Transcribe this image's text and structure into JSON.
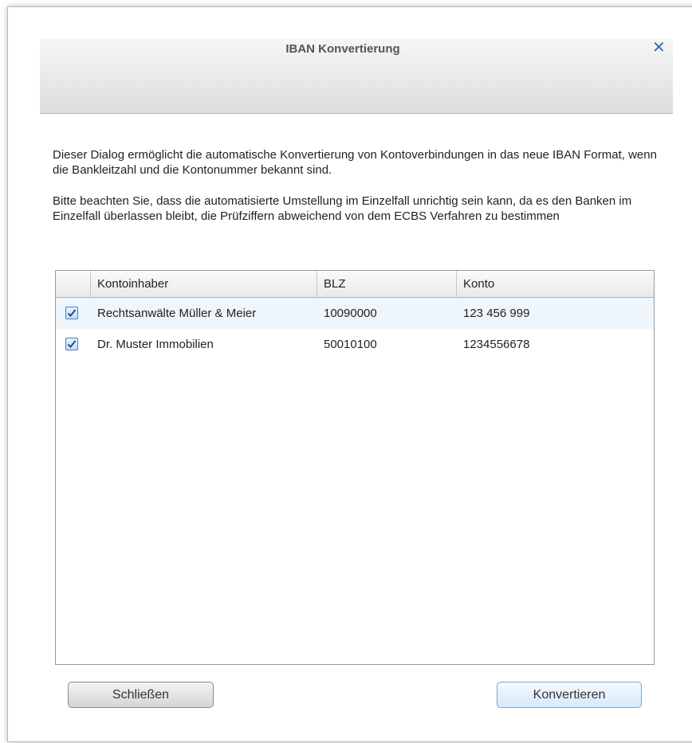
{
  "dialog": {
    "title": "IBAN Konvertierung",
    "close_icon": "close-icon",
    "paragraph1": "Dieser Dialog ermöglicht die automatische Konvertierung von Kontoverbindungen in das neue IBAN Format, wenn die Bankleitzahl und die Kontonummer bekannt sind.",
    "paragraph2": "Bitte beachten Sie, dass die automatisierte Umstellung im Einzelfall unrichtig sein kann, da es den Banken im Einzelfall überlassen bleibt, die Prüfziffern abweichend von dem ECBS Verfahren zu bestimmen"
  },
  "table": {
    "columns": [
      "",
      "Kontoinhaber",
      "BLZ",
      "Konto"
    ],
    "rows": [
      {
        "checked": true,
        "inhaber": "Rechtsanwälte Müller & Meier",
        "blz": "10090000",
        "konto": "123 456 999"
      },
      {
        "checked": true,
        "inhaber": "Dr. Muster Immobilien",
        "blz": "50010100",
        "konto": "1234556678"
      }
    ]
  },
  "buttons": {
    "close_label": "Schließen",
    "convert_label": "Konvertieren"
  },
  "colors": {
    "accent": "#2f6eb5",
    "selected_row": "#eef6fc",
    "checkbox_border": "#4a7fb8"
  }
}
